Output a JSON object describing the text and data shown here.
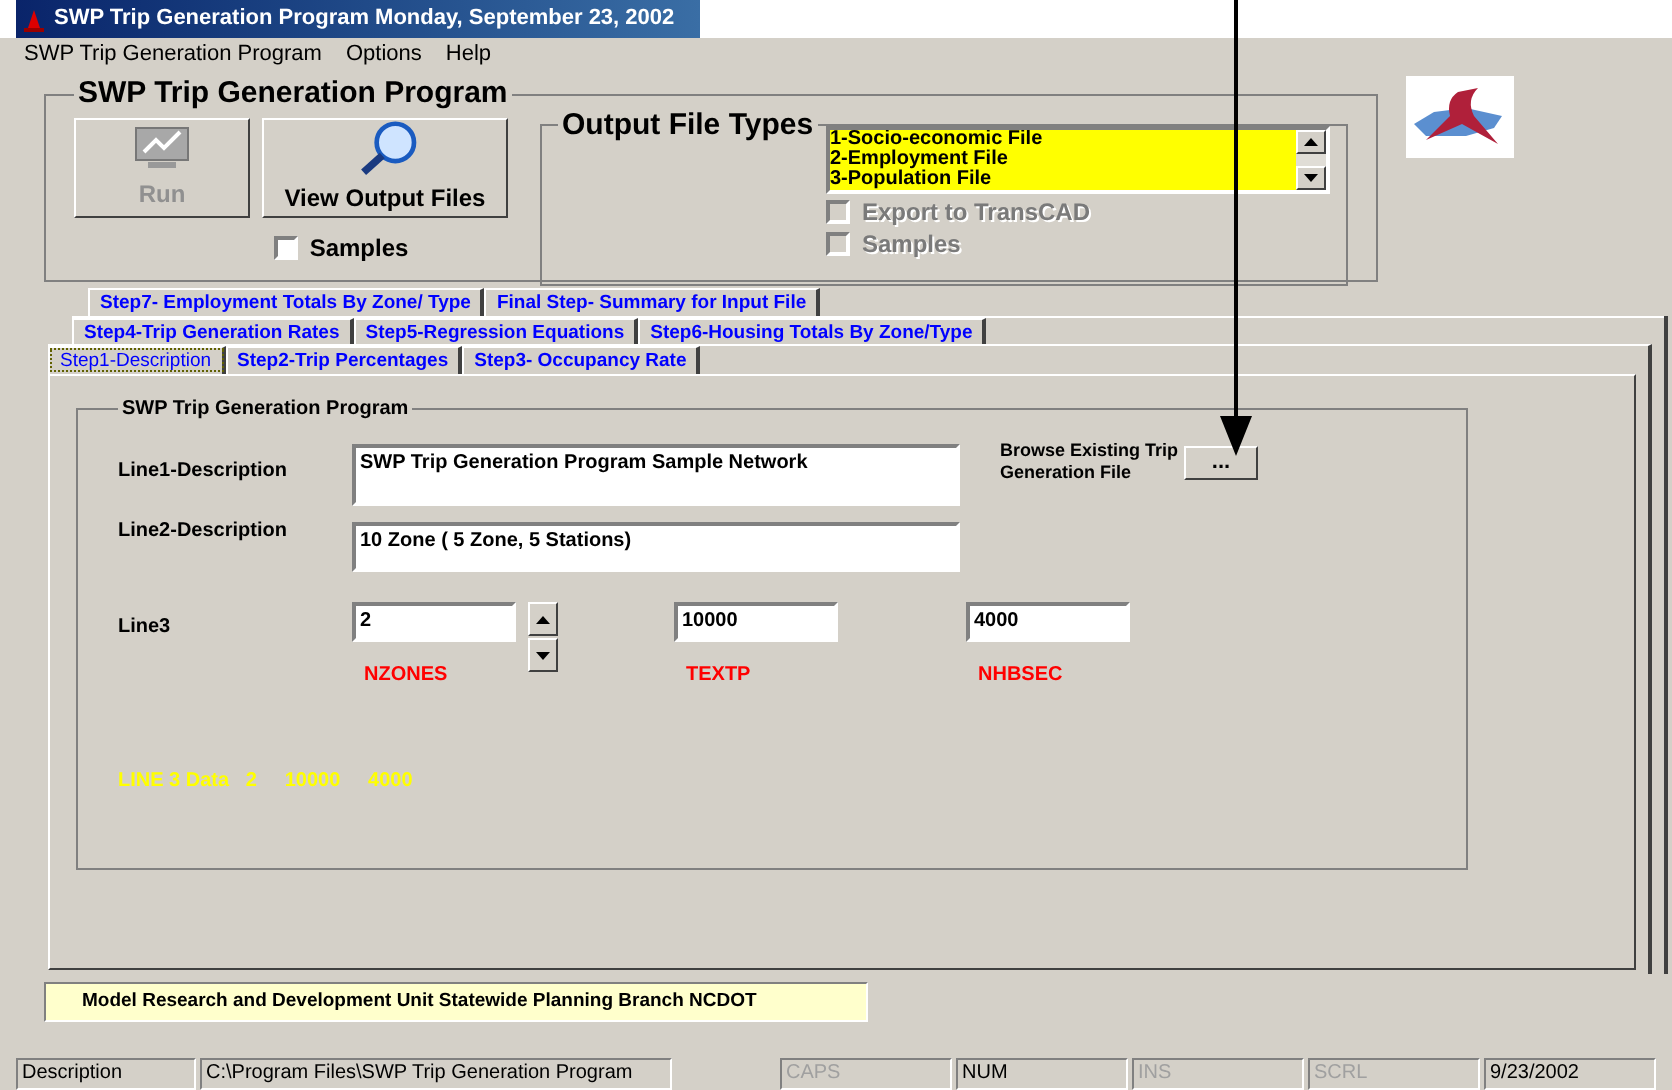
{
  "window": {
    "title": "SWP Trip Generation Program Monday, September 23, 2002"
  },
  "menu": [
    "SWP Trip Generation Program",
    "Options",
    "Help"
  ],
  "main_group": {
    "title": "SWP Trip Generation Program",
    "buttons": [
      {
        "label": "Run",
        "disabled": true,
        "kind": "run"
      },
      {
        "label": "View Output Files",
        "disabled": false,
        "kind": "view"
      }
    ],
    "samples": {
      "label": "Samples",
      "checked": false
    }
  },
  "output_group": {
    "title": "Output File Types",
    "list": [
      "1-Socio-economic File",
      "2-Employment File",
      "3-Population File"
    ],
    "options": [
      {
        "label": "Export to TransCAD",
        "checked": false,
        "disabled": true
      },
      {
        "label": "Samples",
        "checked": false,
        "disabled": true
      }
    ]
  },
  "tab_rows": [
    [
      {
        "label": "Step7- Employment Totals By Zone/ Type",
        "selected": false
      },
      {
        "label": "Final Step- Summary for Input File",
        "selected": false
      }
    ],
    [
      {
        "label": "Step4-Trip Generation Rates",
        "selected": false
      },
      {
        "label": "Step5-Regression Equations",
        "selected": false
      },
      {
        "label": "Step6-Housing Totals By Zone/Type",
        "selected": false
      }
    ],
    [
      {
        "label": "Step1-Description",
        "selected": true
      },
      {
        "label": "Step2-Trip Percentages",
        "selected": false
      },
      {
        "label": "Step3- Occupancy Rate",
        "selected": false
      }
    ]
  ],
  "panel": {
    "title": "SWP Trip Generation Program",
    "line1": {
      "label": "Line1-Description",
      "value": "SWP Trip Generation Program Sample Network"
    },
    "browse": {
      "label": "Browse Existing Trip Generation File",
      "button": "..."
    },
    "line2": {
      "label": "Line2-Description",
      "value": "10 Zone ( 5 Zone, 5 Stations)"
    },
    "line3": {
      "label": "Line3",
      "fields": [
        {
          "value": "2",
          "caption": "NZONES"
        },
        {
          "value": "10000",
          "caption": "TEXTP"
        },
        {
          "value": "4000",
          "caption": "NHBSEC"
        }
      ]
    },
    "summary": "LINE 3 Data   2     10000     4000"
  },
  "footer": "Model Research and Development Unit Statewide Planning Branch  NCDOT",
  "status_bar": [
    {
      "text": "Description",
      "disabled": false
    },
    {
      "text": "C:\\Program Files\\SWP Trip Generation Program",
      "disabled": false
    },
    {
      "text": "CAPS",
      "disabled": true
    },
    {
      "text": "NUM",
      "disabled": false
    },
    {
      "text": "INS",
      "disabled": true
    },
    {
      "text": "SCRL",
      "disabled": true
    },
    {
      "text": "9/23/2002",
      "disabled": false
    }
  ]
}
